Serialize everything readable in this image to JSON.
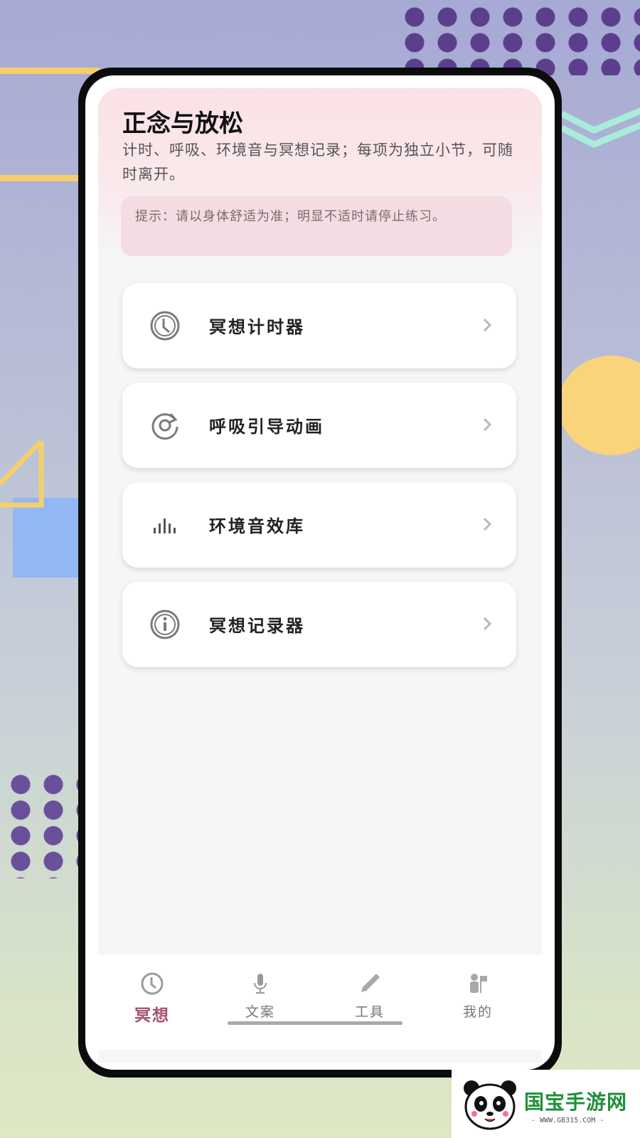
{
  "header": {
    "title": "正念与放松",
    "subtitle": "计时、呼吸、环境音与冥想记录；每项为独立小节，可随时离开。",
    "notice": "提示：请以身体舒适为准；明显不适时请停止练习。"
  },
  "menu": {
    "items": [
      {
        "label": "冥想计时器",
        "icon": "clock-icon"
      },
      {
        "label": "呼吸引导动画",
        "icon": "refresh-icon"
      },
      {
        "label": "环境音效库",
        "icon": "audio-bars-icon"
      },
      {
        "label": "冥想记录器",
        "icon": "info-icon"
      }
    ]
  },
  "nav": {
    "items": [
      {
        "label": "冥想",
        "icon": "clock-icon",
        "active": true
      },
      {
        "label": "文案",
        "icon": "microphone-icon",
        "active": false
      },
      {
        "label": "工具",
        "icon": "pencil-icon",
        "active": false
      },
      {
        "label": "我的",
        "icon": "person-icon",
        "active": false
      }
    ]
  },
  "watermark": {
    "brand": "国宝手游网",
    "url": "- WWW.GB315.COM -"
  },
  "colors": {
    "accent": "#a7516a",
    "hero_pink": "#fbe1e6",
    "notice_bg": "#f4dde2"
  }
}
